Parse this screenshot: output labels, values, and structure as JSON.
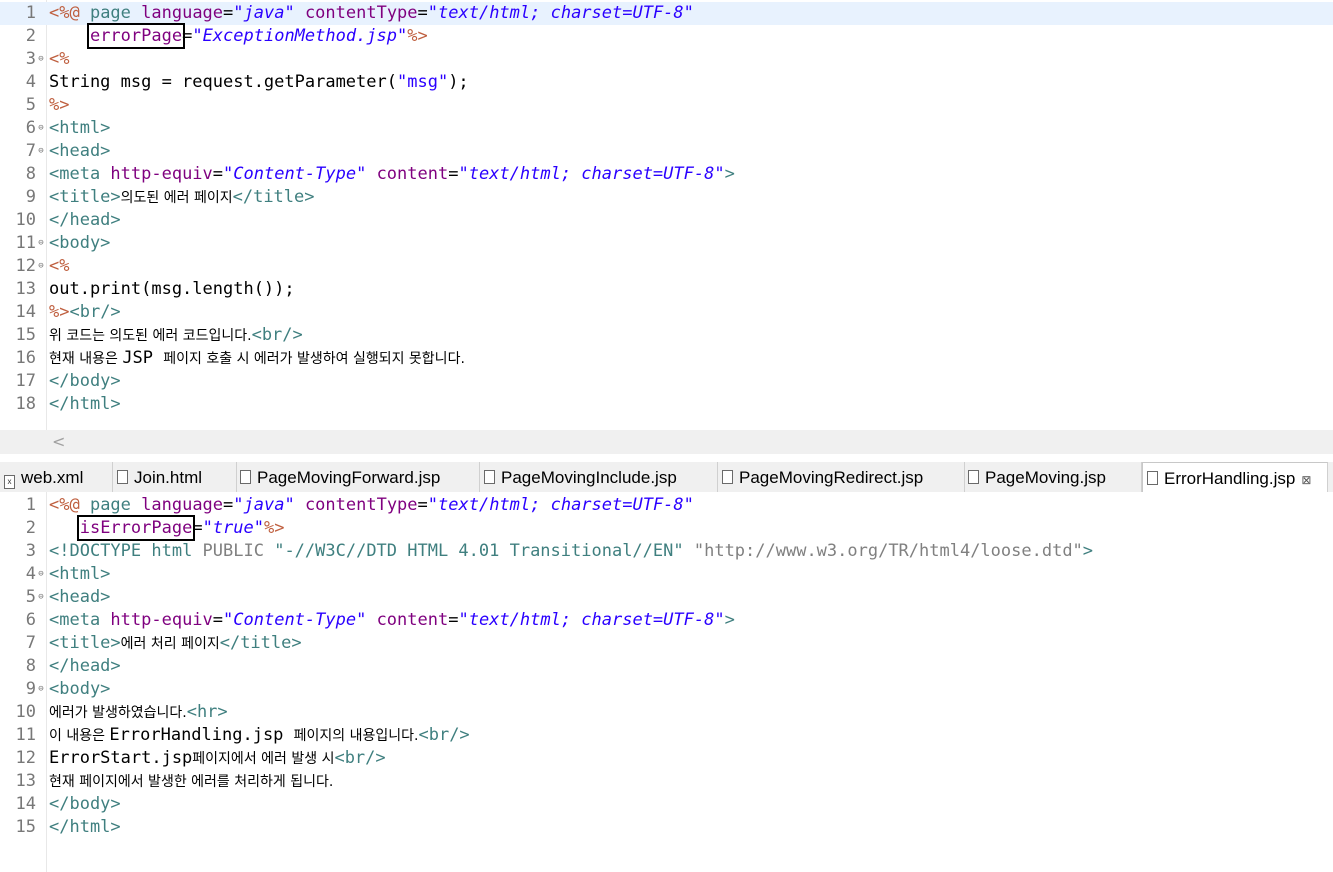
{
  "editor1": {
    "lines": [
      {
        "n": "1",
        "fold": false,
        "current": true,
        "tokens": [
          {
            "t": "<%@ ",
            "c": "kw-delim"
          },
          {
            "t": "page ",
            "c": "kw-tag"
          },
          {
            "t": "language",
            "c": "kw-attr"
          },
          {
            "t": "=",
            "c": "kw-text"
          },
          {
            "t": "\"java\"",
            "c": "kw-str"
          },
          {
            "t": " contentType",
            "c": "kw-attr"
          },
          {
            "t": "=",
            "c": "kw-text"
          },
          {
            "t": "\"text/html; charset=UTF-8\"",
            "c": "kw-str"
          }
        ]
      },
      {
        "n": "2",
        "fold": false,
        "current": false,
        "tokens": [
          {
            "t": "    ",
            "c": "kw-text"
          },
          {
            "t": "errorPage",
            "c": "kw-attr",
            "box": true
          },
          {
            "t": "=",
            "c": "kw-text"
          },
          {
            "t": "\"ExceptionMethod.jsp\"",
            "c": "kw-str"
          },
          {
            "t": "%>",
            "c": "kw-delim"
          }
        ]
      },
      {
        "n": "3",
        "fold": true,
        "current": false,
        "tokens": [
          {
            "t": "<%",
            "c": "kw-delim"
          }
        ]
      },
      {
        "n": "4",
        "fold": false,
        "current": false,
        "tokens": [
          {
            "t": "String msg = request.getParameter(",
            "c": "kw-text"
          },
          {
            "t": "\"msg\"",
            "c": "kw-strn"
          },
          {
            "t": ");",
            "c": "kw-text"
          }
        ]
      },
      {
        "n": "5",
        "fold": false,
        "current": false,
        "tokens": [
          {
            "t": "%>",
            "c": "kw-delim"
          }
        ]
      },
      {
        "n": "6",
        "fold": true,
        "current": false,
        "tokens": [
          {
            "t": "<html>",
            "c": "kw-tag"
          }
        ]
      },
      {
        "n": "7",
        "fold": true,
        "current": false,
        "tokens": [
          {
            "t": "<head>",
            "c": "kw-tag"
          }
        ]
      },
      {
        "n": "8",
        "fold": false,
        "current": false,
        "tokens": [
          {
            "t": "<meta ",
            "c": "kw-tag"
          },
          {
            "t": "http-equiv",
            "c": "kw-attr"
          },
          {
            "t": "=",
            "c": "kw-text"
          },
          {
            "t": "\"Content-Type\"",
            "c": "kw-str"
          },
          {
            "t": " content",
            "c": "kw-attr"
          },
          {
            "t": "=",
            "c": "kw-text"
          },
          {
            "t": "\"text/html; charset=UTF-8\"",
            "c": "kw-str"
          },
          {
            "t": ">",
            "c": "kw-tag"
          }
        ]
      },
      {
        "n": "9",
        "fold": false,
        "current": false,
        "tokens": [
          {
            "t": "<title>",
            "c": "kw-tag"
          },
          {
            "t": "의도된 에러 페이지",
            "c": "kw-text kor"
          },
          {
            "t": "</title>",
            "c": "kw-tag"
          }
        ]
      },
      {
        "n": "10",
        "fold": false,
        "current": false,
        "tokens": [
          {
            "t": "</head>",
            "c": "kw-tag"
          }
        ]
      },
      {
        "n": "11",
        "fold": true,
        "current": false,
        "tokens": [
          {
            "t": "<body>",
            "c": "kw-tag"
          }
        ]
      },
      {
        "n": "12",
        "fold": true,
        "current": false,
        "tokens": [
          {
            "t": "<%",
            "c": "kw-delim"
          }
        ]
      },
      {
        "n": "13",
        "fold": false,
        "current": false,
        "tokens": [
          {
            "t": "out.print(msg.length());",
            "c": "kw-text"
          }
        ]
      },
      {
        "n": "14",
        "fold": false,
        "current": false,
        "tokens": [
          {
            "t": "%>",
            "c": "kw-delim"
          },
          {
            "t": "<br/>",
            "c": "kw-tag"
          }
        ]
      },
      {
        "n": "15",
        "fold": false,
        "current": false,
        "tokens": [
          {
            "t": "위 코드는 의도된 에러 코드입니다.",
            "c": "kw-text kor"
          },
          {
            "t": "<br/>",
            "c": "kw-tag"
          }
        ]
      },
      {
        "n": "16",
        "fold": false,
        "current": false,
        "tokens": [
          {
            "t": "현재 내용은 ",
            "c": "kw-text kor"
          },
          {
            "t": "JSP ",
            "c": "kw-text"
          },
          {
            "t": "페이지 호출 시 에러가 발생하여 실행되지 못합니다.",
            "c": "kw-text kor"
          }
        ]
      },
      {
        "n": "17",
        "fold": false,
        "current": false,
        "tokens": [
          {
            "t": "</body>",
            "c": "kw-tag"
          }
        ]
      },
      {
        "n": "18",
        "fold": false,
        "current": false,
        "tokens": [
          {
            "t": "</html>",
            "c": "kw-tag"
          }
        ]
      }
    ]
  },
  "scrollbar": {
    "left_arrow": "<"
  },
  "tabs": [
    {
      "label": "web.xml",
      "icon": "xml-file-icon",
      "active": false
    },
    {
      "label": "Join.html",
      "icon": "html-file-icon",
      "active": false
    },
    {
      "label": "PageMovingForward.jsp",
      "icon": "jsp-file-icon",
      "active": false
    },
    {
      "label": "PageMovingInclude.jsp",
      "icon": "jsp-file-icon",
      "active": false
    },
    {
      "label": "PageMovingRedirect.jsp",
      "icon": "jsp-file-icon",
      "active": false
    },
    {
      "label": "PageMoving.jsp",
      "icon": "jsp-file-icon",
      "active": false
    },
    {
      "label": "ErrorHandling.jsp",
      "icon": "jsp-file-icon",
      "active": true,
      "close": "⊠"
    }
  ],
  "editor2": {
    "lines": [
      {
        "n": "1",
        "fold": false,
        "current": false,
        "tokens": [
          {
            "t": "<%@ ",
            "c": "kw-delim"
          },
          {
            "t": "page ",
            "c": "kw-tag"
          },
          {
            "t": "language",
            "c": "kw-attr"
          },
          {
            "t": "=",
            "c": "kw-text"
          },
          {
            "t": "\"java\"",
            "c": "kw-str"
          },
          {
            "t": " contentType",
            "c": "kw-attr"
          },
          {
            "t": "=",
            "c": "kw-text"
          },
          {
            "t": "\"text/html; charset=UTF-8\"",
            "c": "kw-str"
          }
        ]
      },
      {
        "n": "2",
        "fold": false,
        "current": false,
        "tokens": [
          {
            "t": "   ",
            "c": "kw-text"
          },
          {
            "t": "isErrorPage",
            "c": "kw-attr",
            "box": true
          },
          {
            "t": "=",
            "c": "kw-text"
          },
          {
            "t": "\"true\"",
            "c": "kw-str"
          },
          {
            "t": "%>",
            "c": "kw-delim"
          }
        ]
      },
      {
        "n": "3",
        "fold": false,
        "current": false,
        "tokens": [
          {
            "t": "<!DOCTYPE ",
            "c": "kw-tag"
          },
          {
            "t": "html ",
            "c": "kw-tag"
          },
          {
            "t": "PUBLIC ",
            "c": "kw-gray"
          },
          {
            "t": "\"-//W3C//DTD HTML 4.01 Transitional//EN\"",
            "c": "kw-tag"
          },
          {
            "t": " ",
            "c": "kw-text"
          },
          {
            "t": "\"http://www.w3.org/TR/html4/loose.dtd\"",
            "c": "kw-gray"
          },
          {
            "t": ">",
            "c": "kw-tag"
          }
        ]
      },
      {
        "n": "4",
        "fold": true,
        "current": false,
        "tokens": [
          {
            "t": "<html>",
            "c": "kw-tag"
          }
        ]
      },
      {
        "n": "5",
        "fold": true,
        "current": false,
        "tokens": [
          {
            "t": "<head>",
            "c": "kw-tag"
          }
        ]
      },
      {
        "n": "6",
        "fold": false,
        "current": false,
        "tokens": [
          {
            "t": "<meta ",
            "c": "kw-tag"
          },
          {
            "t": "http-equiv",
            "c": "kw-attr"
          },
          {
            "t": "=",
            "c": "kw-text"
          },
          {
            "t": "\"Content-Type\"",
            "c": "kw-str"
          },
          {
            "t": " content",
            "c": "kw-attr"
          },
          {
            "t": "=",
            "c": "kw-text"
          },
          {
            "t": "\"text/html; charset=UTF-8\"",
            "c": "kw-str"
          },
          {
            "t": ">",
            "c": "kw-tag"
          }
        ]
      },
      {
        "n": "7",
        "fold": false,
        "current": false,
        "tokens": [
          {
            "t": "<title>",
            "c": "kw-tag"
          },
          {
            "t": "에러 처리 페이지",
            "c": "kw-text kor"
          },
          {
            "t": "</title>",
            "c": "kw-tag"
          }
        ]
      },
      {
        "n": "8",
        "fold": false,
        "current": false,
        "tokens": [
          {
            "t": "</head>",
            "c": "kw-tag"
          }
        ]
      },
      {
        "n": "9",
        "fold": true,
        "current": false,
        "tokens": [
          {
            "t": "<body>",
            "c": "kw-tag"
          }
        ]
      },
      {
        "n": "10",
        "fold": false,
        "current": false,
        "tokens": [
          {
            "t": "에러가 발생하였습니다.",
            "c": "kw-text kor"
          },
          {
            "t": "<hr>",
            "c": "kw-tag"
          }
        ]
      },
      {
        "n": "11",
        "fold": false,
        "current": false,
        "tokens": [
          {
            "t": "이 내용은 ",
            "c": "kw-text kor"
          },
          {
            "t": "ErrorHandling.jsp ",
            "c": "kw-text"
          },
          {
            "t": "페이지의 내용입니다.",
            "c": "kw-text kor"
          },
          {
            "t": "<br/>",
            "c": "kw-tag"
          }
        ]
      },
      {
        "n": "12",
        "fold": false,
        "current": false,
        "tokens": [
          {
            "t": "ErrorStart.jsp",
            "c": "kw-text"
          },
          {
            "t": "페이지에서 에러 발생 시",
            "c": "kw-text kor"
          },
          {
            "t": "<br/>",
            "c": "kw-tag"
          }
        ]
      },
      {
        "n": "13",
        "fold": false,
        "current": false,
        "tokens": [
          {
            "t": "현재 페이지에서 발생한 에러를 처리하게 됩니다.",
            "c": "kw-text kor"
          }
        ]
      },
      {
        "n": "14",
        "fold": false,
        "current": false,
        "tokens": [
          {
            "t": "</body>",
            "c": "kw-tag"
          }
        ]
      },
      {
        "n": "15",
        "fold": false,
        "current": false,
        "tokens": [
          {
            "t": "</html>",
            "c": "kw-tag"
          }
        ]
      }
    ]
  },
  "colors": {
    "tag": "#3f7f7f",
    "attr": "#7f007f",
    "string": "#2a00ff",
    "delim": "#bf5f3f",
    "current_line": "#e8f2fe"
  }
}
